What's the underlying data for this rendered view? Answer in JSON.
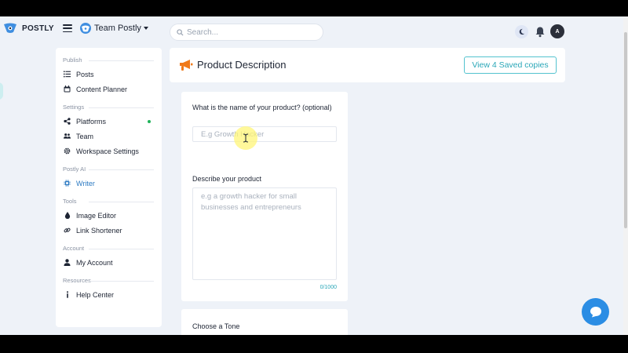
{
  "brand": {
    "name": "POSTLY"
  },
  "header": {
    "team_name": "Team Postly",
    "search_placeholder": "Search...",
    "avatar_initial": "A"
  },
  "sidebar": {
    "sections": [
      {
        "title": "Publish",
        "items": [
          {
            "label": "Posts",
            "icon": "list-icon"
          },
          {
            "label": "Content Planner",
            "icon": "calendar-icon"
          }
        ]
      },
      {
        "title": "Settings",
        "items": [
          {
            "label": "Platforms",
            "icon": "share-icon"
          },
          {
            "label": "Team",
            "icon": "team-icon"
          },
          {
            "label": "Workspace Settings",
            "icon": "gear-icon"
          }
        ]
      },
      {
        "title": "Postly AI",
        "items": [
          {
            "label": "Writer",
            "icon": "chip-icon"
          }
        ]
      },
      {
        "title": "Tools",
        "items": [
          {
            "label": "Image Editor",
            "icon": "drop-icon"
          },
          {
            "label": "Link Shortener",
            "icon": "link-icon"
          }
        ]
      },
      {
        "title": "Account",
        "items": [
          {
            "label": "My Account",
            "icon": "user-icon"
          }
        ]
      },
      {
        "title": "Resources",
        "items": [
          {
            "label": "Help Center",
            "icon": "info-icon"
          }
        ]
      }
    ]
  },
  "main": {
    "title": "Product Description",
    "saved_button": "View 4 Saved copies",
    "product_name": {
      "label": "What is the name of your product? (optional)",
      "placeholder": "E.g Growth Hacker",
      "value": ""
    },
    "product_description": {
      "label": "Describe your product",
      "placeholder": "e.g a growth hacker for small businesses and entrepreneurs",
      "counter": "0/1000"
    },
    "tone": {
      "label": "Choose a Tone"
    }
  },
  "colors": {
    "accent": "#2b79c2",
    "teal": "#2aa7b8",
    "orange": "#f07a1a",
    "status_green": "#20b35a",
    "chat": "#2b8de4"
  }
}
